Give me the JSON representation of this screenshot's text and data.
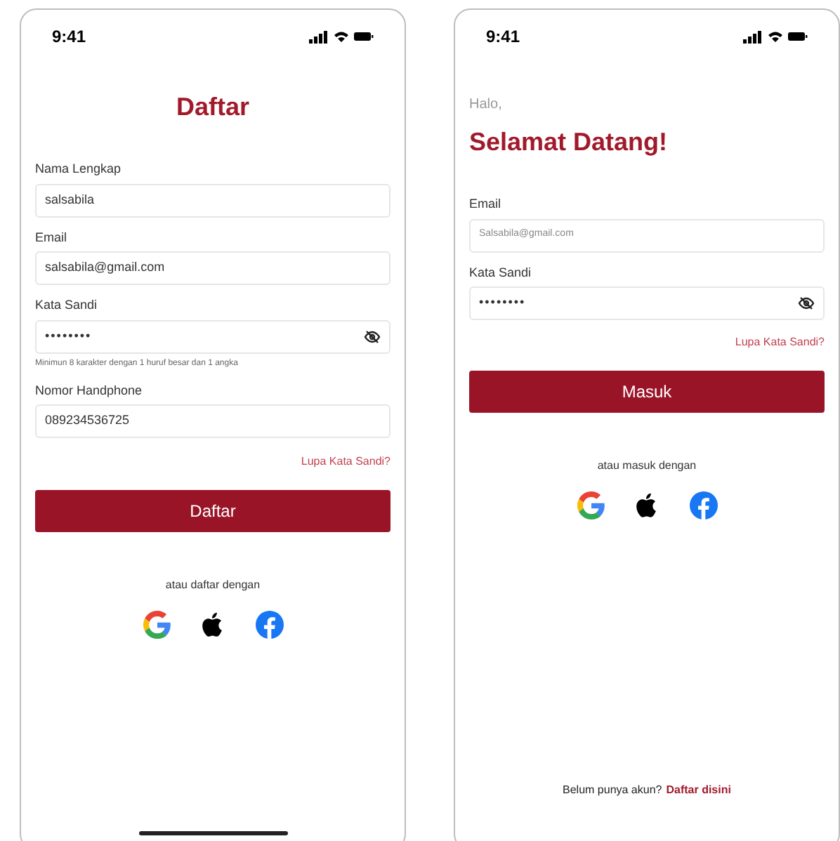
{
  "register": {
    "status_time": "9:41",
    "title": "Daftar",
    "fields": [
      {
        "label": "Nama Lengkap",
        "value": "salsabila",
        "kind": "text"
      },
      {
        "label": "Email",
        "value": "salsabila@gmail.com",
        "kind": "text"
      },
      {
        "label": "Kata Sandi",
        "value": "••••••••",
        "kind": "password",
        "hint": "Minimun 8 karakter dengan 1 huruf besar dan 1 angka"
      },
      {
        "label": "Nomor Handphone",
        "value": "089234536725",
        "kind": "text"
      }
    ],
    "forgot_link": "Lupa Kata Sandi?",
    "submit": "Daftar",
    "social_caption": "atau daftar dengan"
  },
  "login": {
    "status_time": "9:41",
    "greeting": "Halo,",
    "title": "Selamat Datang!",
    "fields": [
      {
        "label": "Email",
        "placeholder": "Salsabila@gmail.com",
        "kind": "text"
      },
      {
        "label": "Kata Sandi",
        "value": "••••••••",
        "kind": "password"
      }
    ],
    "forgot_link": "Lupa Kata Sandi?",
    "submit": "Masuk",
    "social_caption": "atau masuk dengan",
    "footer_text": "Belum punya akun?",
    "footer_link": "Daftar disini"
  }
}
